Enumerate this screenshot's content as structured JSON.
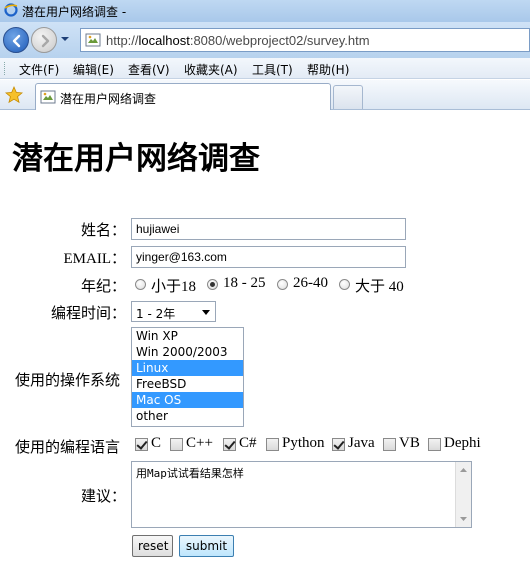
{
  "window": {
    "title": "潜在用户网络调查 -"
  },
  "address_bar": {
    "url_prefix": "http://",
    "url_host": "localhost",
    "url_rest": ":8080/webproject02/survey.htm"
  },
  "menu": [
    "文件(F)",
    "编辑(E)",
    "查看(V)",
    "收藏夹(A)",
    "工具(T)",
    "帮助(H)"
  ],
  "tab": {
    "label": "潜在用户网络调查"
  },
  "page": {
    "title": "潜在用户网络调查",
    "name_label": "姓名：",
    "name_value": "hujiawei",
    "email_label": "EMAIL：",
    "email_value": "yinger@163.com",
    "age_label": "年纪：",
    "age_options": [
      {
        "label": "小于18",
        "checked": false
      },
      {
        "label": "18 - 25",
        "checked": true
      },
      {
        "label": "26-40",
        "checked": false
      },
      {
        "label": "大于 40",
        "checked": false
      }
    ],
    "time_label": "编程时间：",
    "time_value": "1 - 2年",
    "os_label": "使用的操作系统",
    "os_options": [
      {
        "label": "Win XP",
        "selected": false
      },
      {
        "label": "Win 2000/2003",
        "selected": false
      },
      {
        "label": "Linux",
        "selected": true
      },
      {
        "label": "FreeBSD",
        "selected": false
      },
      {
        "label": "Mac OS",
        "selected": true
      },
      {
        "label": "other",
        "selected": false
      }
    ],
    "lang_label": "使用的编程语言",
    "lang_options": [
      {
        "label": "C",
        "checked": true
      },
      {
        "label": "C++",
        "checked": false
      },
      {
        "label": "C#",
        "checked": true
      },
      {
        "label": "Python",
        "checked": false
      },
      {
        "label": "Java",
        "checked": true
      },
      {
        "label": "VB",
        "checked": false
      },
      {
        "label": "Dephi",
        "checked": false
      }
    ],
    "suggest_label": "建议：",
    "suggest_value": "用Map试试看结果怎样",
    "reset_label": "reset",
    "submit_label": "submit"
  }
}
